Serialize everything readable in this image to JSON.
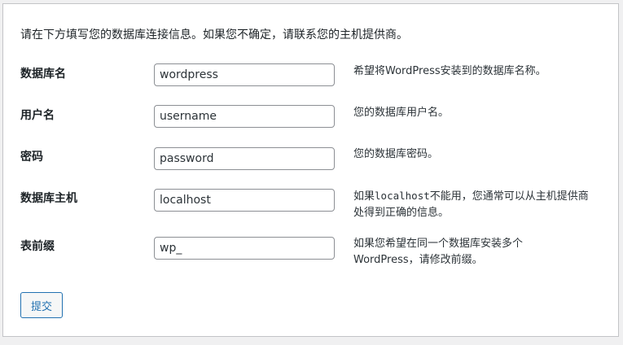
{
  "intro_text": "请在下方填写您的数据库连接信息。如果您不确定，请联系您的主机提供商。",
  "fields": [
    {
      "label": "数据库名",
      "value": "wordpress",
      "description": "希望将WordPress安装到的数据库名称。"
    },
    {
      "label": "用户名",
      "value": "username",
      "description": "您的数据库用户名。"
    },
    {
      "label": "密码",
      "value": "password",
      "description": "您的数据库密码。"
    },
    {
      "label": "数据库主机",
      "value": "localhost",
      "description_prefix": "如果",
      "description_code": "localhost",
      "description_suffix": "不能用，您通常可以从主机提供商处得到正确的信息。"
    },
    {
      "label": "表前缀",
      "value": "wp_",
      "description": "如果您希望在同一个数据库安装多个WordPress，请修改前缀。"
    }
  ],
  "submit_label": "提交",
  "colors": {
    "accent": "#2271b1",
    "border": "#8c8f94",
    "background": "#f0f0f1"
  }
}
